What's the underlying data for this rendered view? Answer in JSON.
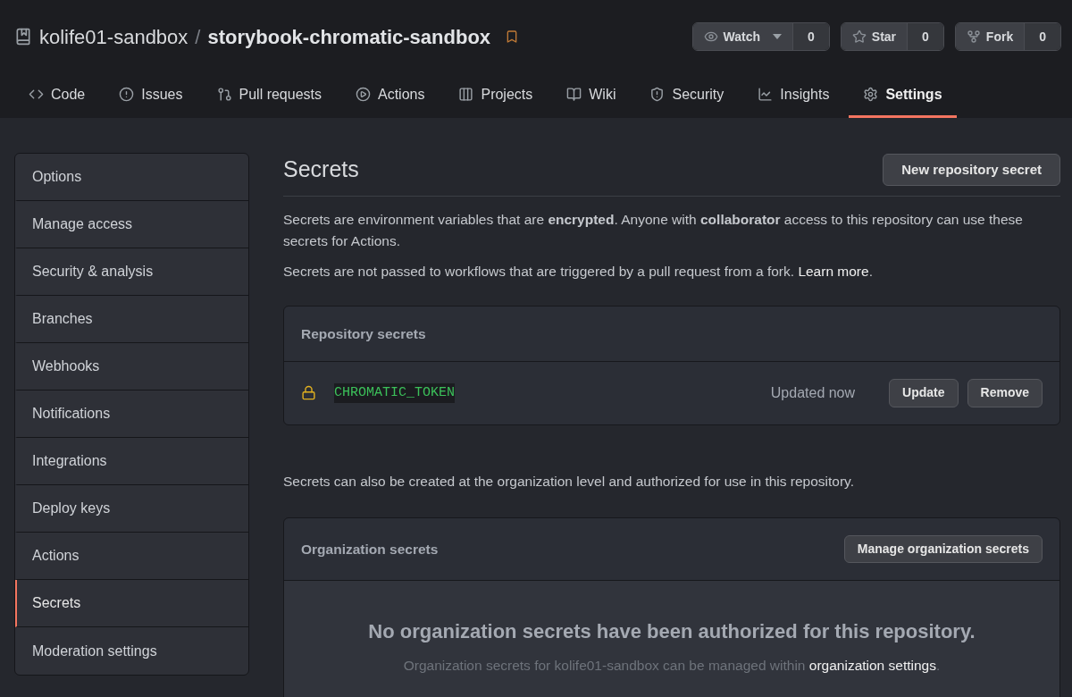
{
  "repo": {
    "owner": "kolife01-sandbox",
    "separator": "/",
    "name": "storybook-chromatic-sandbox"
  },
  "repo_actions": [
    {
      "kind": "watch",
      "label": "Watch",
      "count": "0"
    },
    {
      "kind": "star",
      "label": "Star",
      "count": "0"
    },
    {
      "kind": "fork",
      "label": "Fork",
      "count": "0"
    }
  ],
  "tabs": [
    {
      "kind": "code",
      "label": "Code",
      "selected": false
    },
    {
      "kind": "issues",
      "label": "Issues",
      "selected": false
    },
    {
      "kind": "pulls",
      "label": "Pull requests",
      "selected": false
    },
    {
      "kind": "actions",
      "label": "Actions",
      "selected": false
    },
    {
      "kind": "projects",
      "label": "Projects",
      "selected": false
    },
    {
      "kind": "wiki",
      "label": "Wiki",
      "selected": false
    },
    {
      "kind": "security",
      "label": "Security",
      "selected": false
    },
    {
      "kind": "insights",
      "label": "Insights",
      "selected": false
    },
    {
      "kind": "settings",
      "label": "Settings",
      "selected": true
    }
  ],
  "sidebar": {
    "items": [
      {
        "label": "Options",
        "selected": false
      },
      {
        "label": "Manage access",
        "selected": false
      },
      {
        "label": "Security & analysis",
        "selected": false
      },
      {
        "label": "Branches",
        "selected": false
      },
      {
        "label": "Webhooks",
        "selected": false
      },
      {
        "label": "Notifications",
        "selected": false
      },
      {
        "label": "Integrations",
        "selected": false
      },
      {
        "label": "Deploy keys",
        "selected": false
      },
      {
        "label": "Actions",
        "selected": false
      },
      {
        "label": "Secrets",
        "selected": true
      },
      {
        "label": "Moderation settings",
        "selected": false
      }
    ]
  },
  "page": {
    "title": "Secrets",
    "new_button": "New repository secret",
    "intro": "Secrets are environment variables that are **encrypted**. Anyone with **collaborator** access to this repository can use these secrets for Actions.",
    "note": {
      "text": "Secrets are not passed to workflows that are triggered by a pull request from a fork.",
      "link": "Learn more",
      "after": "."
    }
  },
  "repository_secrets": {
    "title": "Repository secrets",
    "rows": [
      {
        "name": "CHROMATIC_TOKEN",
        "updated": "Updated now",
        "buttons": [
          "Update",
          "Remove"
        ]
      }
    ]
  },
  "org_note": "Secrets can also be created at the organization level and authorized for use in this repository.",
  "organization_secrets": {
    "title": "Organization secrets",
    "button": "Manage organization secrets",
    "empty_title": "No organization secrets have been authorized for this repository.",
    "empty_text": {
      "text": "Organization secrets for kolife01-sandbox can be managed within",
      "link": "organization settings",
      "after": "."
    }
  }
}
